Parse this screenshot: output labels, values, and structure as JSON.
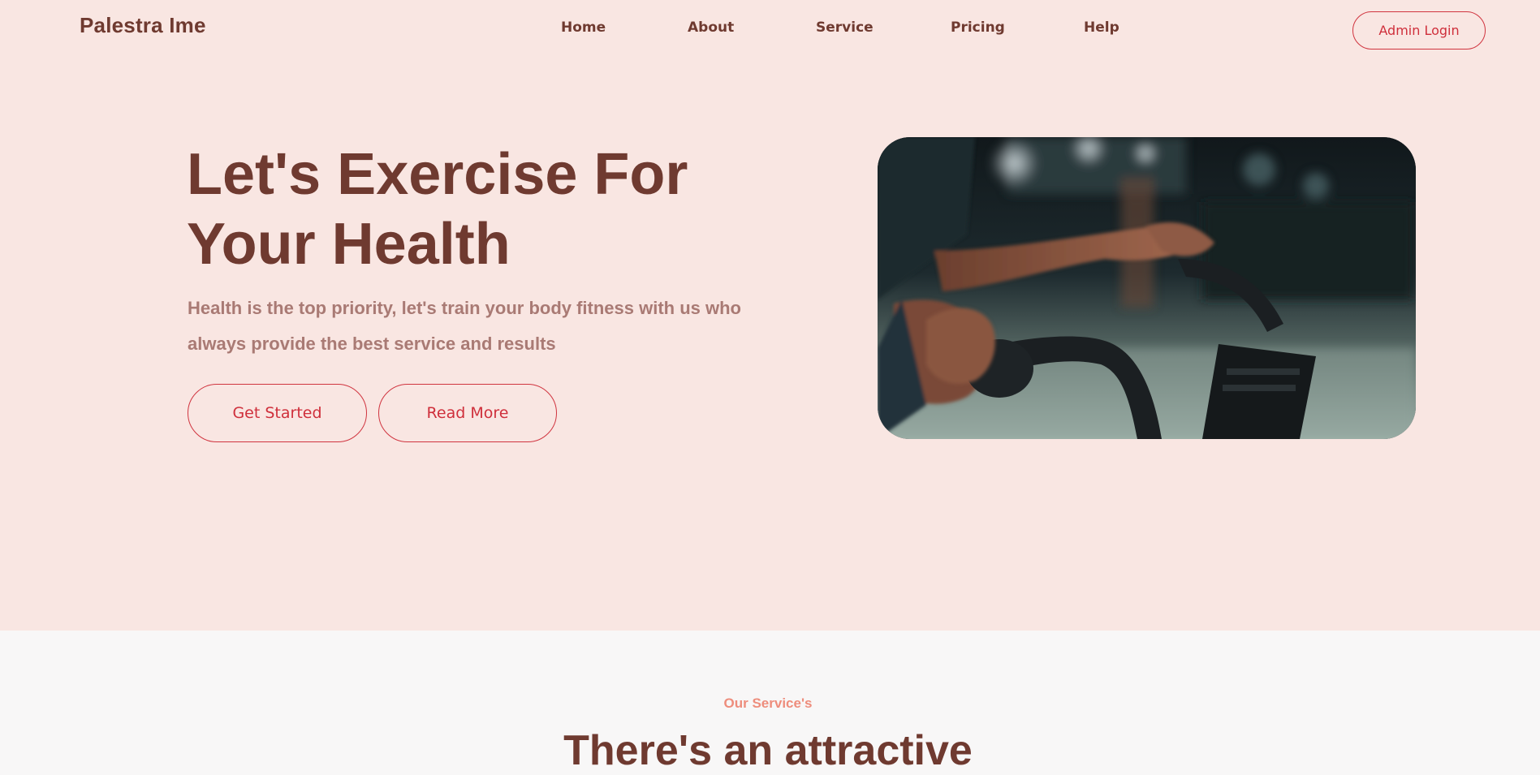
{
  "header": {
    "brand": "Palestra Ime",
    "nav": [
      "Home",
      "About",
      "Service",
      "Pricing",
      "Help"
    ],
    "admin_login": "Admin Login"
  },
  "hero": {
    "title_line1": "Let's Exercise For",
    "title_line2": "Your Health",
    "subtitle_line1": "Health is the top priority, let's train your body fitness with us who",
    "subtitle_line2": "always provide the best service and results",
    "get_started": "Get Started",
    "read_more": "Read More",
    "image": "gym-exercise-bike-photo"
  },
  "services": {
    "kicker": "Our Service's",
    "title": "There's an attractive"
  },
  "colors": {
    "hero_bg": "#f9e6e2",
    "section_bg": "#f8f7f7",
    "heading": "#6f3a30",
    "subtext": "#a97a74",
    "accent": "#d0343f",
    "kicker": "#ee8d7c"
  }
}
